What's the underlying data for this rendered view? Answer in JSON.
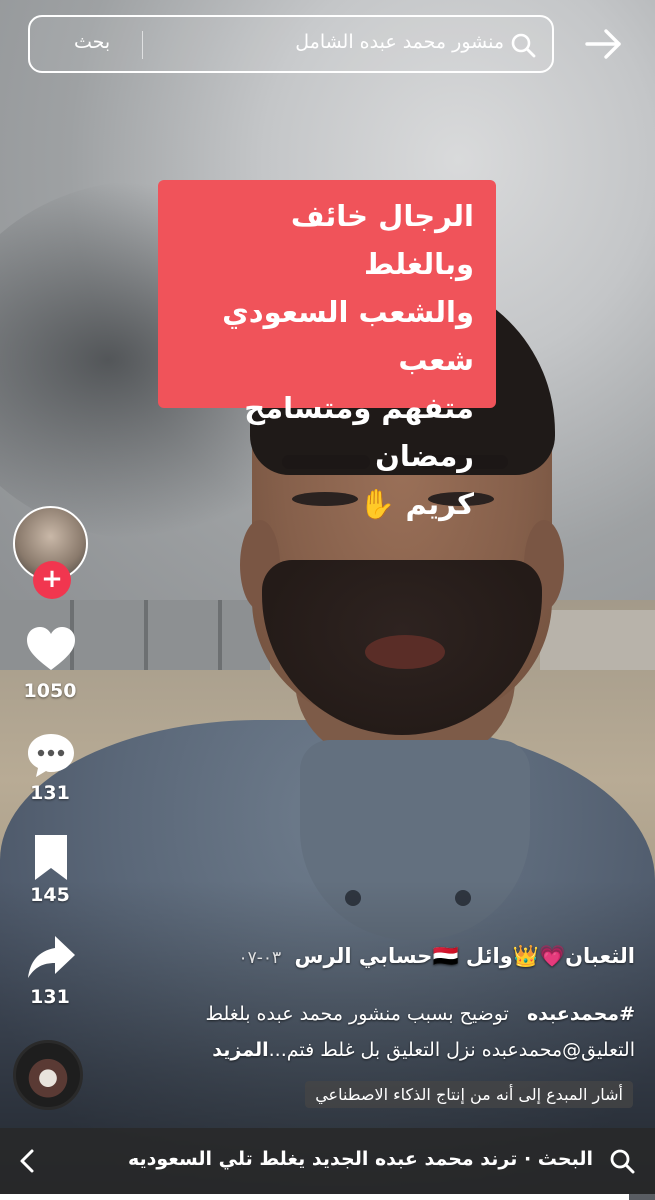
{
  "search": {
    "query": "منشور محمد عبده الشامل",
    "button_label": "بحث"
  },
  "caption": {
    "text": "الرجال خائف وبالغلط\nوالشعب السعودي شعب\nمتفهم ومتسامح رمضان\nكريم ✋"
  },
  "rail": {
    "likes": "1050",
    "comments": "131",
    "saves": "145",
    "shares": "131"
  },
  "post": {
    "author": "الثعبان💗👑وائل 🇾🇪حسابي الرس",
    "date": "٠٣-٠٧",
    "hashtag": "#محمدعبده",
    "description": "توضيح بسبب منشور محمد عبده بلغلط التعليق@محمدعبده  نزل التعليق بل غلط  فتم...",
    "more_label": "المزيد",
    "ai_label": "أشار المبدع إلى أنه من إنتاج الذكاء الاصطناعي"
  },
  "bottom_search": {
    "text": "البحث · ترند محمد عبده الجديد يغلط تلي السعوديه"
  },
  "progress": {
    "fraction": 0.96
  },
  "colors": {
    "caption_bg": "#f0535a",
    "follow_red": "#f1364f"
  },
  "icons": {
    "search": "search-icon",
    "share_top": "share-arrow-icon",
    "like": "heart-icon",
    "comment": "comment-icon",
    "save": "bookmark-icon",
    "share": "share-icon",
    "chevron": "chevron-left-icon"
  }
}
